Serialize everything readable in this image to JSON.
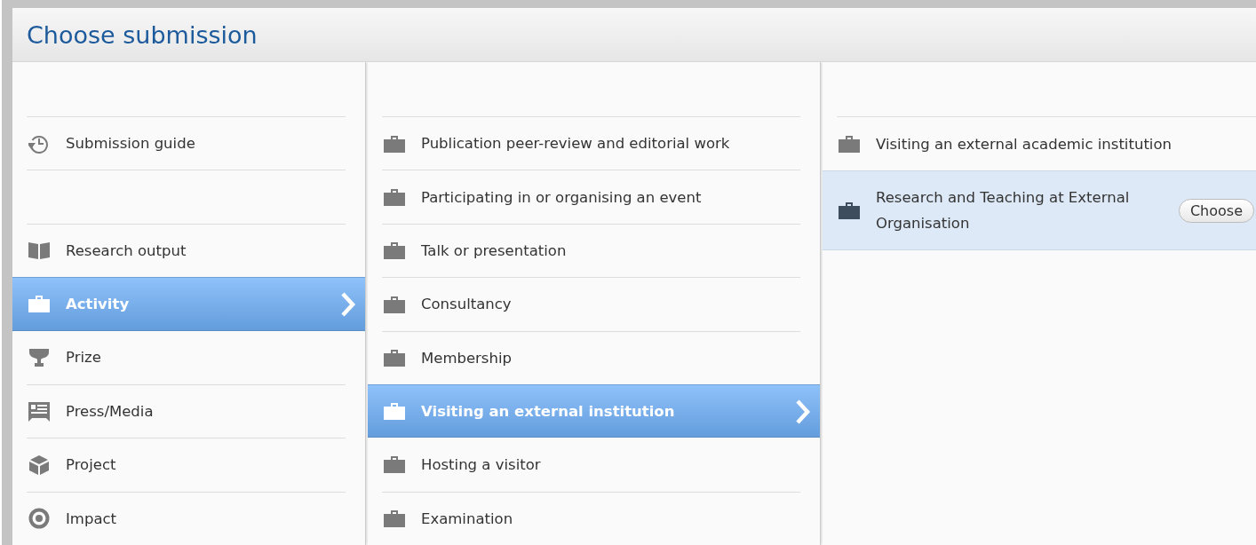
{
  "window": {
    "title": "Choose submission"
  },
  "columns": [
    {
      "items": [
        {
          "label": "Submission guide",
          "kind": "history",
          "selected": false,
          "separated": false
        },
        {
          "label": "Research output",
          "kind": "book",
          "selected": false,
          "separated": true
        },
        {
          "label": "Activity",
          "kind": "briefcase",
          "selected": true,
          "separated": false
        },
        {
          "label": "Prize",
          "kind": "trophy",
          "selected": false,
          "separated": false
        },
        {
          "label": "Press/Media",
          "kind": "press",
          "selected": false,
          "separated": false
        },
        {
          "label": "Project",
          "kind": "cube",
          "selected": false,
          "separated": false
        },
        {
          "label": "Impact",
          "kind": "target",
          "selected": false,
          "separated": false
        }
      ]
    },
    {
      "items": [
        {
          "label": "Publication peer-review and editorial work",
          "kind": "briefcase",
          "selected": false
        },
        {
          "label": "Participating in or organising an event",
          "kind": "briefcase",
          "selected": false
        },
        {
          "label": "Talk or presentation",
          "kind": "briefcase",
          "selected": false
        },
        {
          "label": "Consultancy",
          "kind": "briefcase",
          "selected": false
        },
        {
          "label": "Membership",
          "kind": "briefcase",
          "selected": false
        },
        {
          "label": "Visiting an external institution",
          "kind": "briefcase",
          "selected": true
        },
        {
          "label": "Hosting a visitor",
          "kind": "briefcase",
          "selected": false
        },
        {
          "label": "Examination",
          "kind": "briefcase",
          "selected": false
        }
      ]
    },
    {
      "items": [
        {
          "label": "Visiting an external academic institution",
          "kind": "briefcase",
          "selected": false,
          "hovered": false
        },
        {
          "label": "Research and Teaching at External Organisation",
          "kind": "briefcase",
          "selected": false,
          "hovered": true,
          "action": "Choose"
        }
      ]
    }
  ]
}
